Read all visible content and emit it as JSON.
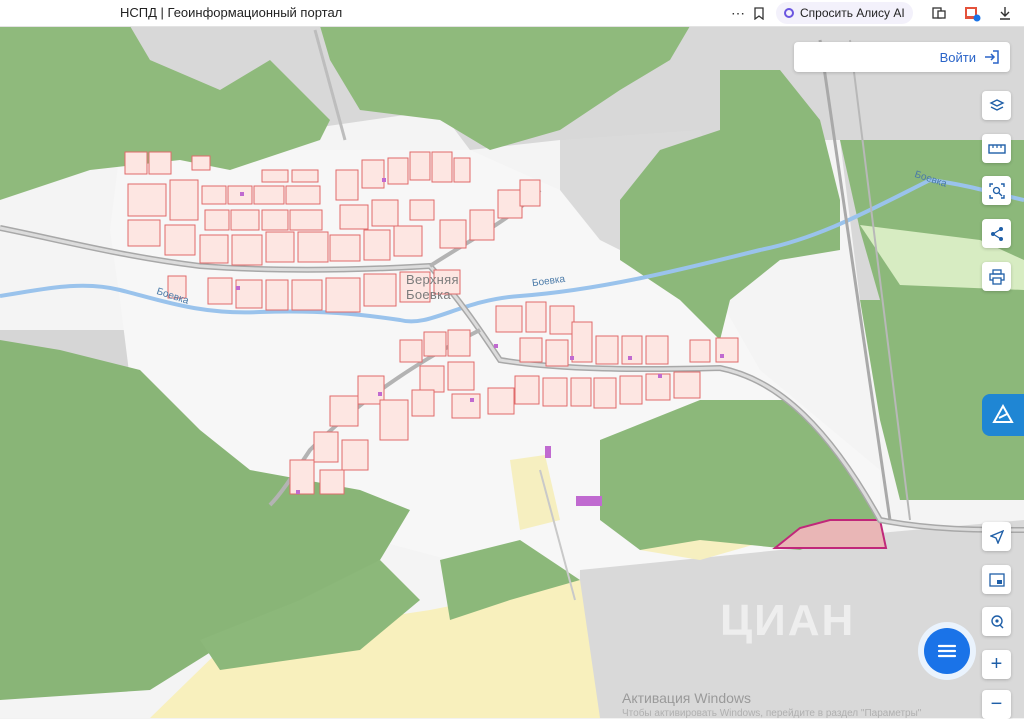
{
  "browser": {
    "page_title": "НСПД | Геоинформационный портал",
    "alice_label": "Спросить Алису AI"
  },
  "map": {
    "settlement_label_line1": "Верхняя",
    "settlement_label_line2": "Боевка",
    "river_labels": [
      "Боевка",
      "Боевка",
      "Боевка"
    ],
    "watermark": "ЦИАН",
    "login_label": "Войти",
    "zoom_in": "+",
    "zoom_out": "−"
  },
  "system": {
    "activation_title": "Активация Windows",
    "activation_hint": "Чтобы активировать Windows, перейдите в раздел \"Параметры\""
  },
  "colors": {
    "forest": "#8cb87a",
    "field": "#f8f0bd",
    "built": "#d6d6d6",
    "river": "#9ac3ec",
    "parcel_stroke": "#e06a6a",
    "parcel_fill": "#fde6e2",
    "accent": "#1a73e8",
    "highlight": "#c0287a"
  }
}
